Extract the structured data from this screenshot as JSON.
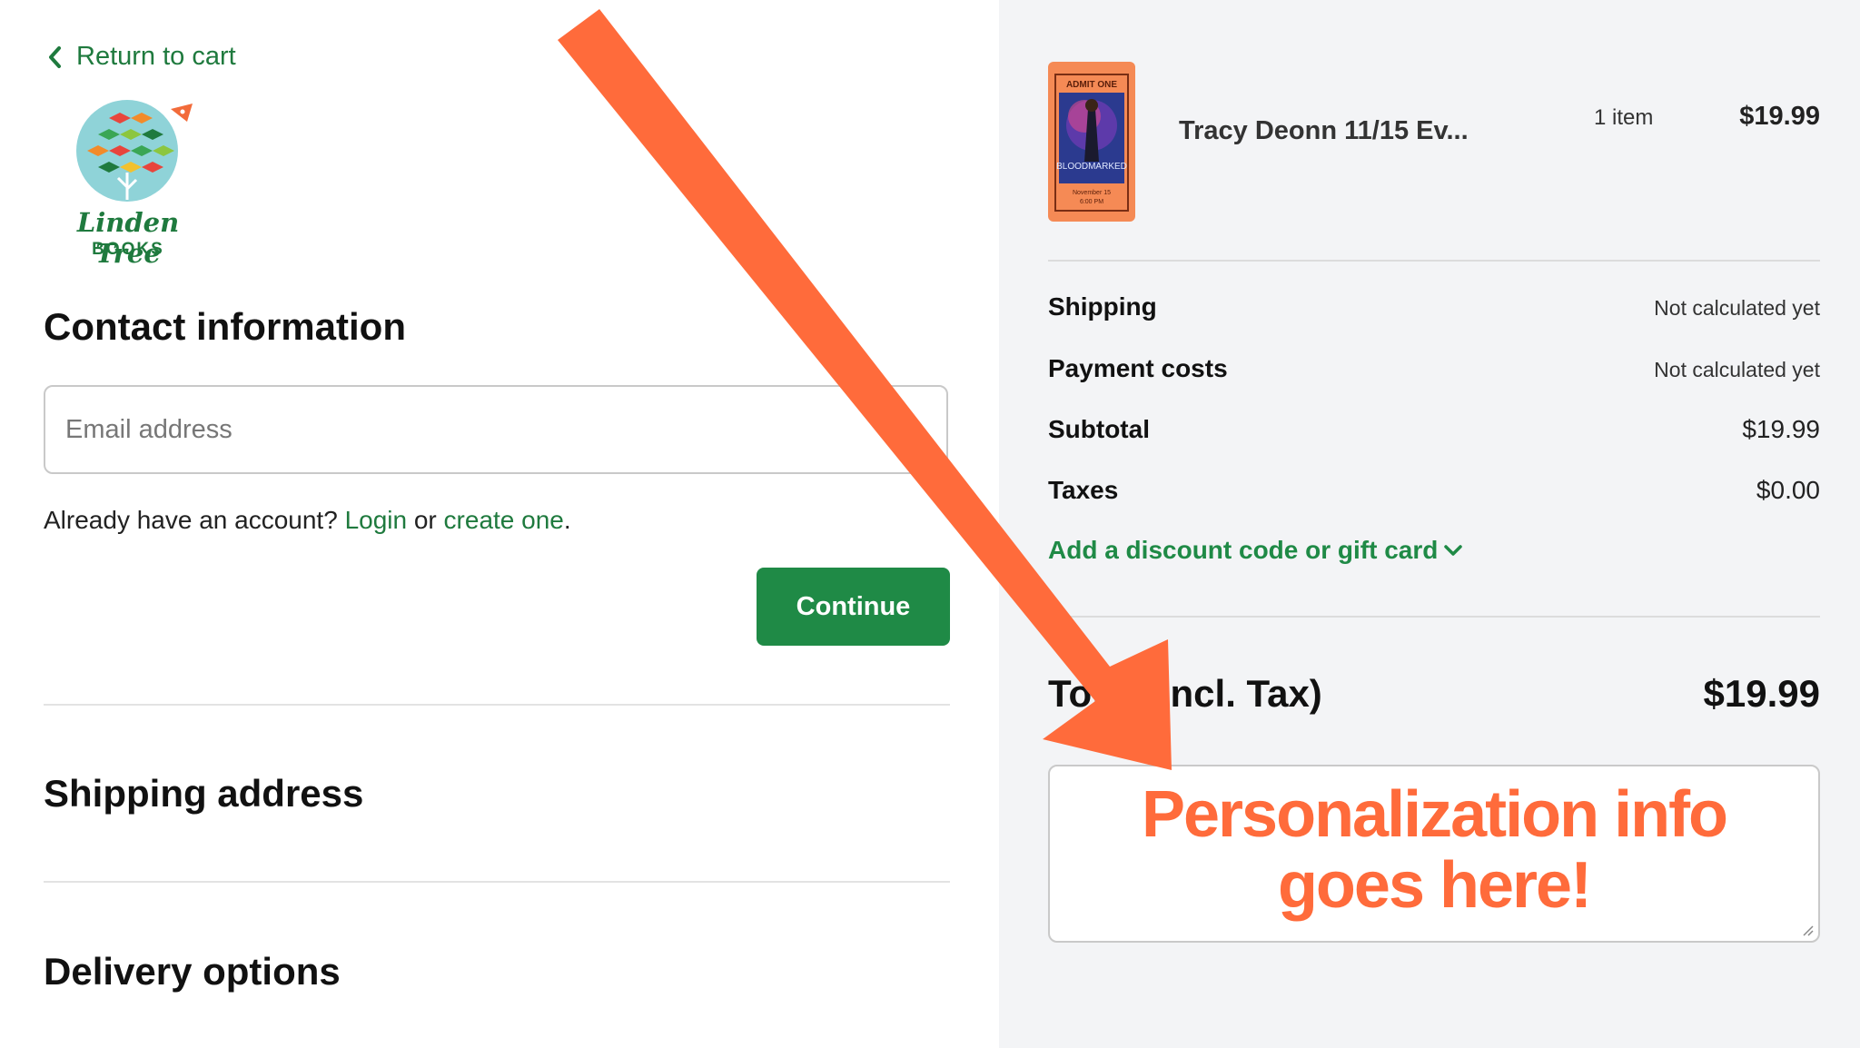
{
  "left": {
    "return_label": "Return to cart",
    "logo": {
      "name": "Linden Tree",
      "sub": "BOOKS"
    },
    "contact_heading": "Contact information",
    "email_placeholder": "Email address",
    "account_prefix": "Already have an account?",
    "login_label": "Login",
    "or_text": "or",
    "create_label": "create one",
    "period": ".",
    "continue_label": "Continue",
    "shipping_heading": "Shipping address",
    "delivery_heading": "Delivery options"
  },
  "summary": {
    "product": {
      "name": "Tracy Deonn 11/15 Ev...",
      "count": "1 item",
      "price": "$19.99",
      "thumb_top": "ADMIT ONE",
      "thumb_title": "BLOODMARKED",
      "thumb_date": "November 15",
      "thumb_time": "6:00 PM"
    },
    "rows": [
      {
        "label": "Shipping",
        "value": "Not calculated yet"
      },
      {
        "label": "Payment costs",
        "value": "Not calculated yet"
      },
      {
        "label": "Subtotal",
        "value": "$19.99"
      },
      {
        "label": "Taxes",
        "value": "$0.00"
      }
    ],
    "discount_label": "Add a discount code or gift card",
    "total_label": "Total (Incl. Tax)",
    "total_value": "$19.99"
  },
  "overlay": {
    "line1": "Personalization info",
    "line2": "goes here!",
    "color": "#ff6b3b"
  },
  "colors": {
    "brand_green": "#1f8a46",
    "link_green": "#1f7a3e",
    "summary_bg": "#f3f4f6"
  },
  "icons": {
    "back": "chevron-left-icon",
    "discount": "chevron-down-icon",
    "grip": "resize-grip-icon"
  }
}
